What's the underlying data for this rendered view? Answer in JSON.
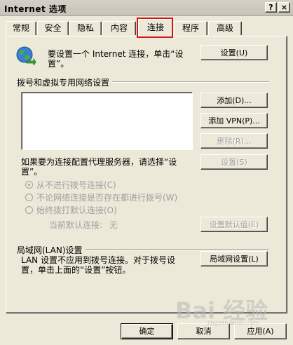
{
  "window": {
    "title": "Internet 选项",
    "help_label": "?",
    "close_label": "×"
  },
  "tabs": [
    {
      "label": "常规"
    },
    {
      "label": "安全"
    },
    {
      "label": "隐私"
    },
    {
      "label": "内容"
    },
    {
      "label": "连接"
    },
    {
      "label": "程序"
    },
    {
      "label": "高级"
    }
  ],
  "setup": {
    "text_line1": "要设置一个 Internet 连接，单击“设",
    "text_line2": "置”。",
    "button_label": "设置(U)"
  },
  "dialup": {
    "section_label": "拨号和虚拟专用网络设置",
    "add_label": "添加(D)...",
    "add_vpn_label": "添加 VPN(P)...",
    "delete_label": "删除(R)...",
    "settings_label": "设置(S)",
    "proxy_text_line1": "如果要为连接配置代理服务器，请选择“设",
    "proxy_text_line2": "置”。",
    "options": [
      {
        "label": "从不进行拨号连接(C)"
      },
      {
        "label": "不论网络连接是否存在都进行拨号(W)"
      },
      {
        "label": "始终拨打默认连接(O)"
      }
    ],
    "current_default_label": "当前默认连接:",
    "current_default_value": "无",
    "set_default_label": "设置默认值(E)"
  },
  "lan": {
    "section_label": "局域网(LAN)设置",
    "text_line1": "LAN 设置不应用到拨号连接。对于拨号设",
    "text_line2": "置，单击上面的“设置”按钮。",
    "button_label": "局域网设置(L)"
  },
  "footer": {
    "ok_label": "确定",
    "cancel_label": "取消",
    "apply_label": "应用(A)"
  },
  "watermark": {
    "text": "Bai 经验",
    "url": "jingyan.baidu.com"
  }
}
